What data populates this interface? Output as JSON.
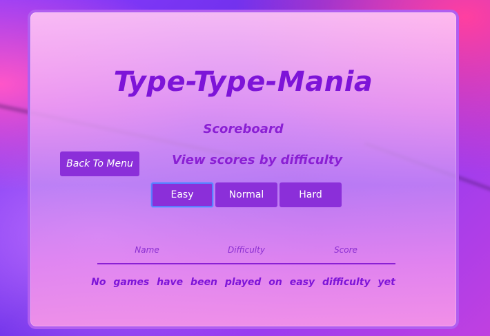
{
  "app": {
    "title": "Type-Type-Mania",
    "subtitle": "Scoreboard",
    "view_label": "View scores by difficulty"
  },
  "nav": {
    "back_label": "Back To Menu"
  },
  "difficulty_tabs": [
    {
      "label": "Easy",
      "active": true
    },
    {
      "label": "Normal",
      "active": false
    },
    {
      "label": "Hard",
      "active": false
    }
  ],
  "table": {
    "headers": [
      "Name",
      "Difficulty",
      "Score"
    ],
    "empty_message": "No games have been played on easy difficulty yet"
  },
  "colors": {
    "accent": "#8b2fd9",
    "title": "#7d14d8",
    "panel_border": "#b15ef0",
    "active_tab_outline": "#5a7dff"
  }
}
